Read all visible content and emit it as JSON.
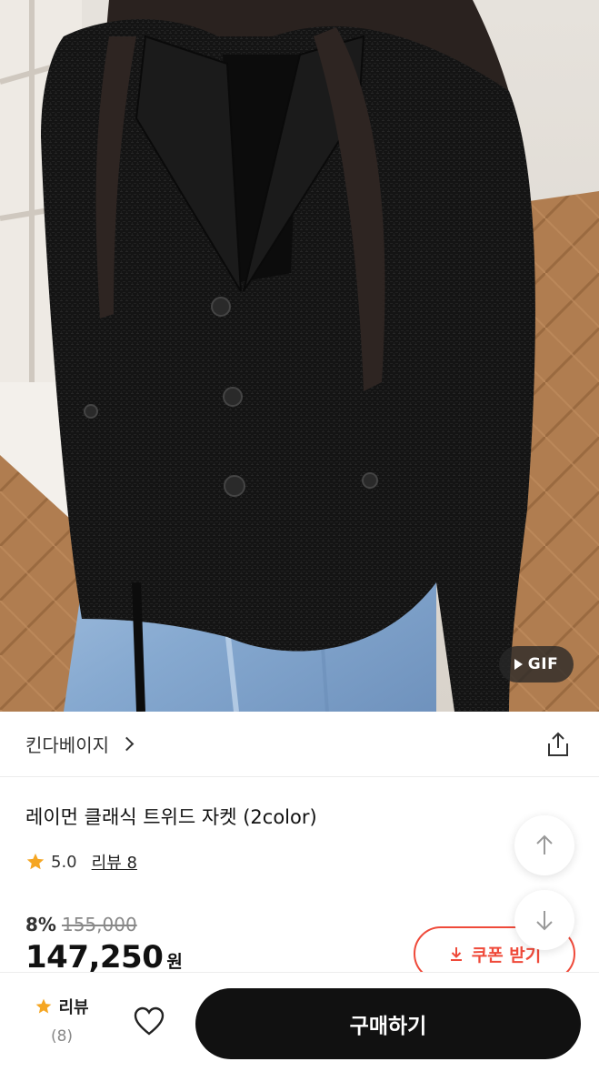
{
  "photo": {
    "gif_label": "GIF",
    "accent_jacket": "#141414",
    "accent_floor": "#b07d50",
    "accent_denim": "#8fb1d6"
  },
  "brand": {
    "name": "킨다베이지",
    "chevron_icon": "chevron-right-icon",
    "share_icon": "share-icon"
  },
  "product": {
    "title": "레이먼 클래식 트위드 자켓 (2color)",
    "rating": "5.0",
    "review_link": "리뷰 8",
    "discount": "8%",
    "original_price": "155,000",
    "price": "147,250",
    "price_unit": "원"
  },
  "coupon": {
    "label": "쿠폰 받기",
    "icon": "download-icon",
    "color": "#ef4a3a"
  },
  "floating": {
    "up_icon": "arrow-up-icon",
    "down_icon": "arrow-down-icon"
  },
  "bottom_bar": {
    "review_label": "리뷰",
    "review_count": "(8)",
    "heart_icon": "heart-icon",
    "buy_label": "구매하기",
    "star_color": "#f5a623"
  }
}
